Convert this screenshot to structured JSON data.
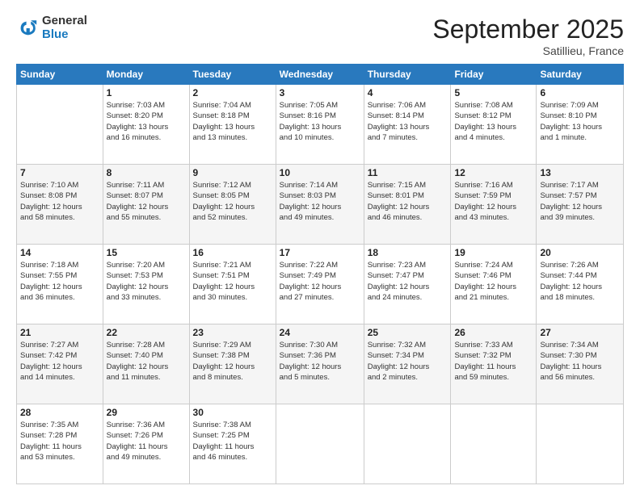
{
  "header": {
    "logo_general": "General",
    "logo_blue": "Blue",
    "month_title": "September 2025",
    "location": "Satillieu, France"
  },
  "days_of_week": [
    "Sunday",
    "Monday",
    "Tuesday",
    "Wednesday",
    "Thursday",
    "Friday",
    "Saturday"
  ],
  "weeks": [
    [
      {
        "day": "",
        "info": ""
      },
      {
        "day": "1",
        "info": "Sunrise: 7:03 AM\nSunset: 8:20 PM\nDaylight: 13 hours\nand 16 minutes."
      },
      {
        "day": "2",
        "info": "Sunrise: 7:04 AM\nSunset: 8:18 PM\nDaylight: 13 hours\nand 13 minutes."
      },
      {
        "day": "3",
        "info": "Sunrise: 7:05 AM\nSunset: 8:16 PM\nDaylight: 13 hours\nand 10 minutes."
      },
      {
        "day": "4",
        "info": "Sunrise: 7:06 AM\nSunset: 8:14 PM\nDaylight: 13 hours\nand 7 minutes."
      },
      {
        "day": "5",
        "info": "Sunrise: 7:08 AM\nSunset: 8:12 PM\nDaylight: 13 hours\nand 4 minutes."
      },
      {
        "day": "6",
        "info": "Sunrise: 7:09 AM\nSunset: 8:10 PM\nDaylight: 13 hours\nand 1 minute."
      }
    ],
    [
      {
        "day": "7",
        "info": "Sunrise: 7:10 AM\nSunset: 8:08 PM\nDaylight: 12 hours\nand 58 minutes."
      },
      {
        "day": "8",
        "info": "Sunrise: 7:11 AM\nSunset: 8:07 PM\nDaylight: 12 hours\nand 55 minutes."
      },
      {
        "day": "9",
        "info": "Sunrise: 7:12 AM\nSunset: 8:05 PM\nDaylight: 12 hours\nand 52 minutes."
      },
      {
        "day": "10",
        "info": "Sunrise: 7:14 AM\nSunset: 8:03 PM\nDaylight: 12 hours\nand 49 minutes."
      },
      {
        "day": "11",
        "info": "Sunrise: 7:15 AM\nSunset: 8:01 PM\nDaylight: 12 hours\nand 46 minutes."
      },
      {
        "day": "12",
        "info": "Sunrise: 7:16 AM\nSunset: 7:59 PM\nDaylight: 12 hours\nand 43 minutes."
      },
      {
        "day": "13",
        "info": "Sunrise: 7:17 AM\nSunset: 7:57 PM\nDaylight: 12 hours\nand 39 minutes."
      }
    ],
    [
      {
        "day": "14",
        "info": "Sunrise: 7:18 AM\nSunset: 7:55 PM\nDaylight: 12 hours\nand 36 minutes."
      },
      {
        "day": "15",
        "info": "Sunrise: 7:20 AM\nSunset: 7:53 PM\nDaylight: 12 hours\nand 33 minutes."
      },
      {
        "day": "16",
        "info": "Sunrise: 7:21 AM\nSunset: 7:51 PM\nDaylight: 12 hours\nand 30 minutes."
      },
      {
        "day": "17",
        "info": "Sunrise: 7:22 AM\nSunset: 7:49 PM\nDaylight: 12 hours\nand 27 minutes."
      },
      {
        "day": "18",
        "info": "Sunrise: 7:23 AM\nSunset: 7:47 PM\nDaylight: 12 hours\nand 24 minutes."
      },
      {
        "day": "19",
        "info": "Sunrise: 7:24 AM\nSunset: 7:46 PM\nDaylight: 12 hours\nand 21 minutes."
      },
      {
        "day": "20",
        "info": "Sunrise: 7:26 AM\nSunset: 7:44 PM\nDaylight: 12 hours\nand 18 minutes."
      }
    ],
    [
      {
        "day": "21",
        "info": "Sunrise: 7:27 AM\nSunset: 7:42 PM\nDaylight: 12 hours\nand 14 minutes."
      },
      {
        "day": "22",
        "info": "Sunrise: 7:28 AM\nSunset: 7:40 PM\nDaylight: 12 hours\nand 11 minutes."
      },
      {
        "day": "23",
        "info": "Sunrise: 7:29 AM\nSunset: 7:38 PM\nDaylight: 12 hours\nand 8 minutes."
      },
      {
        "day": "24",
        "info": "Sunrise: 7:30 AM\nSunset: 7:36 PM\nDaylight: 12 hours\nand 5 minutes."
      },
      {
        "day": "25",
        "info": "Sunrise: 7:32 AM\nSunset: 7:34 PM\nDaylight: 12 hours\nand 2 minutes."
      },
      {
        "day": "26",
        "info": "Sunrise: 7:33 AM\nSunset: 7:32 PM\nDaylight: 11 hours\nand 59 minutes."
      },
      {
        "day": "27",
        "info": "Sunrise: 7:34 AM\nSunset: 7:30 PM\nDaylight: 11 hours\nand 56 minutes."
      }
    ],
    [
      {
        "day": "28",
        "info": "Sunrise: 7:35 AM\nSunset: 7:28 PM\nDaylight: 11 hours\nand 53 minutes."
      },
      {
        "day": "29",
        "info": "Sunrise: 7:36 AM\nSunset: 7:26 PM\nDaylight: 11 hours\nand 49 minutes."
      },
      {
        "day": "30",
        "info": "Sunrise: 7:38 AM\nSunset: 7:25 PM\nDaylight: 11 hours\nand 46 minutes."
      },
      {
        "day": "",
        "info": ""
      },
      {
        "day": "",
        "info": ""
      },
      {
        "day": "",
        "info": ""
      },
      {
        "day": "",
        "info": ""
      }
    ]
  ]
}
